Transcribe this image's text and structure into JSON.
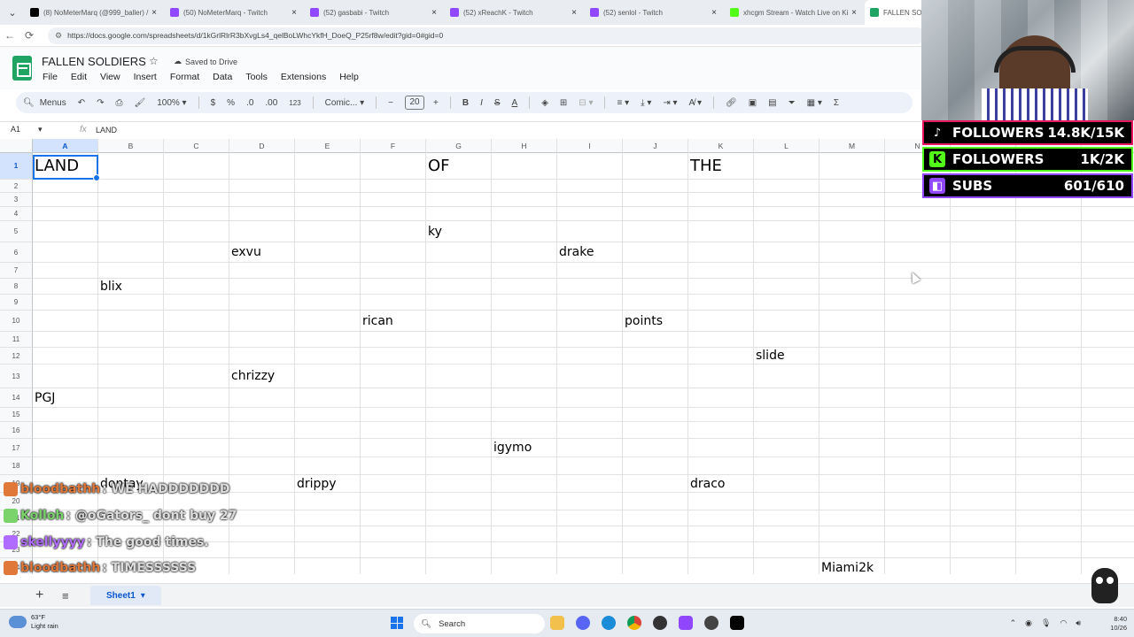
{
  "browser": {
    "tabs": [
      {
        "title": "(8) NoMeterMarq (@999_baller) /",
        "favicon": "x-icon",
        "color": "#000000"
      },
      {
        "title": "(50) NoMeterMarq - Twitch",
        "favicon": "twitch-icon",
        "color": "#9146ff"
      },
      {
        "title": "(52) gasbabi - Twitch",
        "favicon": "twitch-icon",
        "color": "#9146ff"
      },
      {
        "title": "(52) xReachK - Twitch",
        "favicon": "twitch-icon",
        "color": "#9146ff"
      },
      {
        "title": "(52) senlol - Twitch",
        "favicon": "twitch-icon",
        "color": "#9146ff"
      },
      {
        "title": "xhcgm Stream - Watch Live on Ki",
        "favicon": "kick-icon",
        "color": "#53fc18"
      },
      {
        "title": "FALLEN SOL",
        "favicon": "sheets-icon",
        "color": "#1fa463"
      }
    ],
    "url": "https://docs.google.com/spreadsheets/d/1kGrlRlrR3bXvgLs4_qelBoLWhcYkfH_DoeQ_P25rf8w/edit?gid=0#gid=0"
  },
  "sheet": {
    "title": "FALLEN SOLDIERS",
    "saved_status": "Saved to Drive",
    "menu": [
      "File",
      "Edit",
      "View",
      "Insert",
      "Format",
      "Data",
      "Tools",
      "Extensions",
      "Help"
    ],
    "toolbar": {
      "menus_label": "Menus",
      "zoom": "100%",
      "currency": "$",
      "percent": "%",
      "dec_down": ".0",
      "dec_up": ".00",
      "number_format": "123",
      "font": "Comic...",
      "font_size": "20"
    },
    "cell_ref": "A1",
    "formula_value": "LAND",
    "columns": [
      "A",
      "B",
      "C",
      "D",
      "E",
      "F",
      "G",
      "H",
      "I",
      "J",
      "K",
      "L",
      "M",
      "N"
    ],
    "rows": [
      "1",
      "2",
      "3",
      "4",
      "5",
      "6",
      "7",
      "8",
      "9",
      "10",
      "11",
      "12",
      "13",
      "14",
      "15",
      "16",
      "17",
      "18",
      "19",
      "20",
      "21",
      "22",
      "23",
      "24"
    ],
    "cells": [
      {
        "ref": "A1",
        "text": "LAND"
      },
      {
        "ref": "G1",
        "text": "OF"
      },
      {
        "ref": "K1",
        "text": "THE"
      },
      {
        "ref": "G5",
        "text": "ky"
      },
      {
        "ref": "D6",
        "text": "exvu"
      },
      {
        "ref": "I6",
        "text": "drake"
      },
      {
        "ref": "B8",
        "text": "blix"
      },
      {
        "ref": "F10",
        "text": "rican"
      },
      {
        "ref": "J10",
        "text": "points"
      },
      {
        "ref": "L12",
        "text": "slide"
      },
      {
        "ref": "D13",
        "text": "chrizzy"
      },
      {
        "ref": "A14",
        "text": "PGJ"
      },
      {
        "ref": "H17",
        "text": "igymo"
      },
      {
        "ref": "B19",
        "text": "dontay"
      },
      {
        "ref": "E19",
        "text": "drippy"
      },
      {
        "ref": "K19",
        "text": "draco"
      },
      {
        "ref": "M24",
        "text": "Miami2k"
      }
    ],
    "sheet_tab": "Sheet1"
  },
  "overlay": {
    "stats": [
      {
        "platform": "tiktok",
        "label": "FOLLOWERS",
        "value": "14.8K/15K",
        "color": "#e8175d"
      },
      {
        "platform": "kick",
        "label": "FOLLOWERS",
        "value": "1K/2K",
        "color": "#53fc18"
      },
      {
        "platform": "twitch",
        "label": "SUBS",
        "value": "601/610",
        "color": "#9146ff"
      }
    ],
    "chat": [
      {
        "user": "bloodbathh",
        "color": "#e0783a",
        "message": ": WE HADDDDDDD"
      },
      {
        "user": "Kolloh",
        "color": "#7ad36b",
        "message": ": @oGators_ dont buy 27"
      },
      {
        "user": "skellyyyy",
        "color": "#b06bff",
        "message": ": The good times."
      },
      {
        "user": "bloodbathh",
        "color": "#e0783a",
        "message": ": TIMESSSSSS"
      }
    ]
  },
  "taskbar": {
    "temperature": "63°F",
    "condition": "Light rain",
    "search": "Search",
    "time": "8:40",
    "date": "10/26"
  }
}
